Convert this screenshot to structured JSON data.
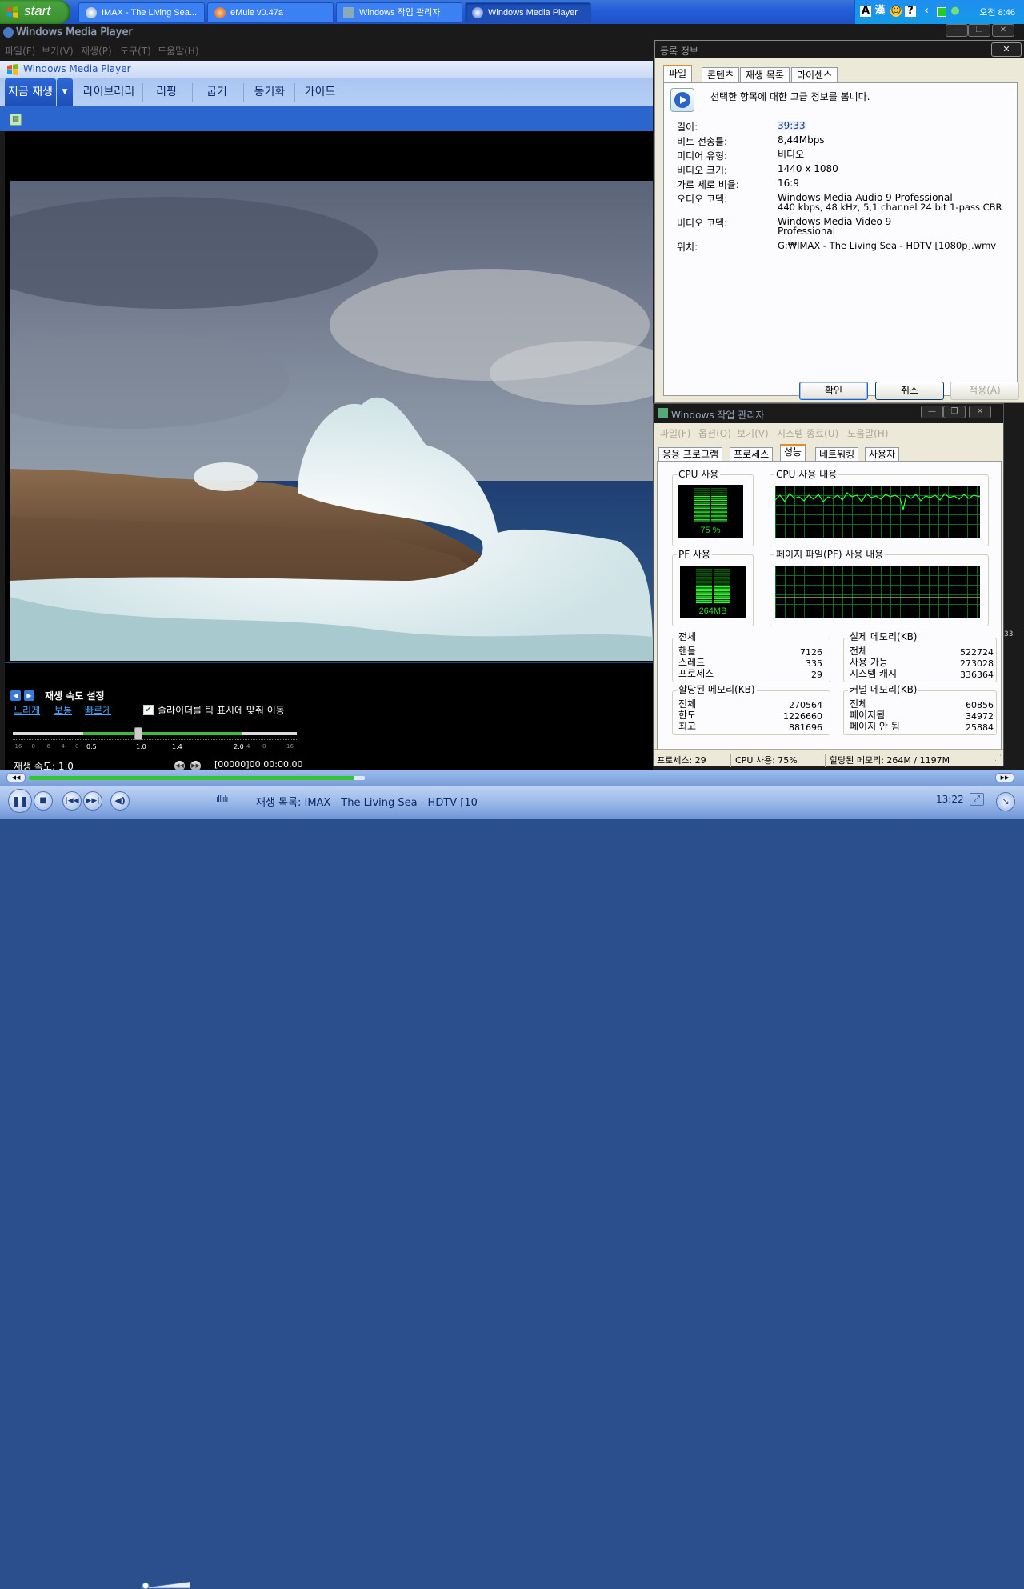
{
  "taskbar": {
    "start_label": "start",
    "tasks": [
      {
        "label": "IMAX - The Living Sea..."
      },
      {
        "label": "eMule v0.47a"
      },
      {
        "label": "Windows 작업 관리자"
      },
      {
        "label": "Windows Media Player"
      }
    ],
    "tray": {
      "ime_a": "A",
      "ime_han": "漢",
      "help": "?",
      "clock": "오전 8:46"
    }
  },
  "wmp": {
    "window_title": "Windows Media Player",
    "menu": [
      "파일(F)",
      "보기(V)",
      "재생(P)",
      "도구(T)",
      "도움말(H)"
    ],
    "inner_title": "Windows Media Player",
    "tabs": [
      "지금 재생",
      "라이브러리",
      "리핑",
      "굽기",
      "동기화",
      "가이드"
    ],
    "enhancement": {
      "title": "재생 속도 설정",
      "presets": [
        "느리게",
        "보통",
        "빠르게"
      ],
      "snap_label": "슬라이더를 틱 표시에 맞춰 이동",
      "snap_checked": true,
      "tick_labels_minor": [
        "-16",
        "-8",
        "-6",
        "-4",
        "0",
        "4",
        "8",
        "16"
      ],
      "tick_labels_major": [
        "0.5",
        "1.0",
        "1.4",
        "2.0"
      ],
      "speed_value": 1.0,
      "rate_label": "재생 속도: 1,0",
      "timecode": "[00000]00:00:00,00"
    },
    "seek_progress": 0.97,
    "now_playing": "재생 목록: IMAX - The Living Sea - HDTV [10",
    "time": "13:22",
    "side_time_fragment": "33"
  },
  "properties": {
    "title": "등록 정보",
    "close": "✕",
    "tabs": [
      "파일",
      "콘텐츠",
      "재생 목록",
      "라이센스"
    ],
    "description": "선택한 항목에 대한 고급 정보를 봅니다.",
    "rows": [
      {
        "key": "길이:",
        "value": "39:33"
      },
      {
        "key": "비트 전송률:",
        "value": "8,44Mbps"
      },
      {
        "key": "미디어 유형:",
        "value": "비디오"
      },
      {
        "key": "비디오 크기:",
        "value": "1440 x 1080"
      },
      {
        "key": "가로 세로 비율:",
        "value": "16:9"
      },
      {
        "key": "오디오 코덱:",
        "value": "Windows Media Audio 9 Professional",
        "value2": "440 kbps, 48 kHz, 5,1 channel 24 bit 1-pass CBR"
      },
      {
        "key": "비디오 코덱:",
        "value": "Windows Media Video 9",
        "value2": "Professional"
      },
      {
        "key": "위치:",
        "value": "G:₩IMAX - The Living Sea - HDTV [1080p].wmv"
      }
    ],
    "buttons": {
      "ok": "확인",
      "cancel": "취소",
      "apply": "적용(A)"
    }
  },
  "taskmgr": {
    "title": "Windows 작업 관리자",
    "menu": [
      "파일(F)",
      "옵션(O)",
      "보기(V)",
      "시스템 종료(U)",
      "도움말(H)"
    ],
    "tabs": [
      "응용 프로그램",
      "프로세스",
      "성능",
      "네트워킹",
      "사용자"
    ],
    "cpu_usage_label": "CPU 사용",
    "cpu_usage_value": "75 %",
    "cpu_usage_percent": 75,
    "cpu_history_label": "CPU 사용 내용",
    "pf_usage_label": "PF 사용",
    "pf_usage_value": "264MB",
    "pf_history_label": "페이지 파일(PF) 사용 내용",
    "totals": {
      "label": "전체",
      "rows": [
        [
          "핸들",
          "7126"
        ],
        [
          "스레드",
          "335"
        ],
        [
          "프로세스",
          "29"
        ]
      ]
    },
    "physical": {
      "label": "실제 메모리(KB)",
      "rows": [
        [
          "전체",
          "522724"
        ],
        [
          "사용 가능",
          "273028"
        ],
        [
          "시스템 캐시",
          "336364"
        ]
      ]
    },
    "commit": {
      "label": "할당된 메모리(KB)",
      "rows": [
        [
          "전체",
          "270564"
        ],
        [
          "한도",
          "1226660"
        ],
        [
          "최고",
          "881696"
        ]
      ]
    },
    "kernel": {
      "label": "커널 메모리(KB)",
      "rows": [
        [
          "전체",
          "60856"
        ],
        [
          "페이지됨",
          "34972"
        ],
        [
          "페이지 안 됨",
          "25884"
        ]
      ]
    },
    "status": {
      "processes": "프로세스: 29",
      "cpu": "CPU 사용: 75%",
      "commit": "할당된 메모리: 264M / 1197M"
    }
  }
}
